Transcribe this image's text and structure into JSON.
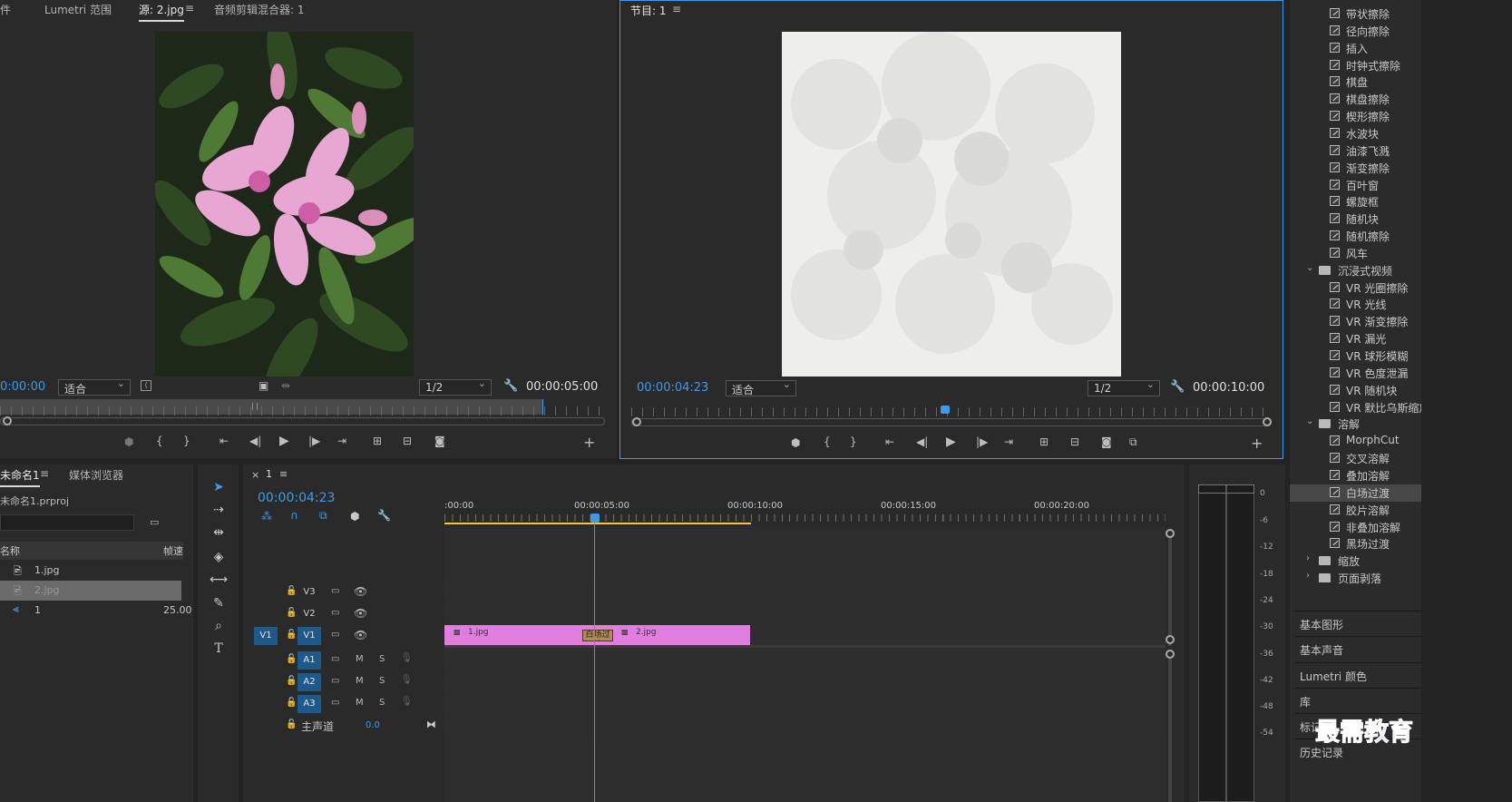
{
  "source_monitor": {
    "tabs": [
      "件",
      "Lumetri 范围",
      "源: 2.jpg",
      "音频剪辑混合器: 1"
    ],
    "menu_icon": "≡",
    "timecode_in": "0:00:00",
    "fit": "适合",
    "resolution": "1/2",
    "timecode_out": "00:00:05:00",
    "image_alt": "pink-azalea-flower-photo"
  },
  "program_monitor": {
    "tab": "节目: 1",
    "menu_icon": "≡",
    "timecode_in": "00:00:04:23",
    "fit": "适合",
    "resolution": "1/2",
    "timecode_out": "00:00:10:00",
    "playhead_fraction": 0.49
  },
  "project_panel": {
    "tabs": [
      "未命名1",
      "媒体浏览器"
    ],
    "menu_icon": "≡",
    "project_file": "未命名1.prproj",
    "columns": [
      "名称",
      "帧速"
    ],
    "items": [
      {
        "name": "1.jpg",
        "rate": "",
        "type": "image"
      },
      {
        "name": "2.jpg",
        "rate": "",
        "type": "image",
        "selected": true
      },
      {
        "name": "1",
        "rate": "25.00",
        "type": "sequence"
      }
    ]
  },
  "timeline": {
    "close": "×",
    "name": "1",
    "menu_icon": "≡",
    "timecode": "00:00:04:23",
    "ruler_labels": [
      ":00:00",
      "00:00:05:00",
      "00:00:10:00",
      "00:00:15:00",
      "00:00:20:00"
    ],
    "video_tracks": [
      {
        "label": "V3",
        "target": ""
      },
      {
        "label": "V2",
        "target": ""
      },
      {
        "label": "V1",
        "target": "V1"
      }
    ],
    "audio_tracks": [
      {
        "label": "A1",
        "m": "M",
        "s": "S"
      },
      {
        "label": "A2",
        "m": "M",
        "s": "S"
      },
      {
        "label": "A3",
        "m": "M",
        "s": "S"
      }
    ],
    "master": {
      "label": "主声道",
      "value": "0.0"
    },
    "clips": [
      {
        "name": "1.jpg"
      },
      {
        "name": "2.jpg"
      }
    ],
    "transition": "白场过渡"
  },
  "audio_meter": {
    "labels": [
      "0",
      "-6",
      "-12",
      "-18",
      "-24",
      "-30",
      "-36",
      "-42",
      "-48",
      "-54"
    ]
  },
  "effects_panel": {
    "items": [
      {
        "type": "item",
        "label": "带状擦除"
      },
      {
        "type": "item",
        "label": "径向擦除"
      },
      {
        "type": "item",
        "label": "插入"
      },
      {
        "type": "item",
        "label": "时钟式擦除"
      },
      {
        "type": "item",
        "label": "棋盘"
      },
      {
        "type": "item",
        "label": "棋盘擦除"
      },
      {
        "type": "item",
        "label": "楔形擦除"
      },
      {
        "type": "item",
        "label": "水波块"
      },
      {
        "type": "item",
        "label": "油漆飞溅"
      },
      {
        "type": "item",
        "label": "渐变擦除"
      },
      {
        "type": "item",
        "label": "百叶窗"
      },
      {
        "type": "item",
        "label": "螺旋框"
      },
      {
        "type": "item",
        "label": "随机块"
      },
      {
        "type": "item",
        "label": "随机擦除"
      },
      {
        "type": "item",
        "label": "风车"
      },
      {
        "type": "folder",
        "label": "沉浸式视频",
        "open": true
      },
      {
        "type": "item",
        "label": "VR 光圈擦除"
      },
      {
        "type": "item",
        "label": "VR 光线"
      },
      {
        "type": "item",
        "label": "VR 渐变擦除"
      },
      {
        "type": "item",
        "label": "VR 漏光"
      },
      {
        "type": "item",
        "label": "VR 球形模糊"
      },
      {
        "type": "item",
        "label": "VR 色度泄漏"
      },
      {
        "type": "item",
        "label": "VR 随机块"
      },
      {
        "type": "item",
        "label": "VR 默比乌斯缩放"
      },
      {
        "type": "folder",
        "label": "溶解",
        "open": true
      },
      {
        "type": "item",
        "label": "MorphCut"
      },
      {
        "type": "item",
        "label": "交叉溶解"
      },
      {
        "type": "item",
        "label": "叠加溶解"
      },
      {
        "type": "item",
        "label": "白场过渡",
        "selected": true
      },
      {
        "type": "item",
        "label": "胶片溶解"
      },
      {
        "type": "item",
        "label": "非叠加溶解"
      },
      {
        "type": "item",
        "label": "黑场过渡"
      },
      {
        "type": "folder",
        "label": "缩放",
        "open": false
      },
      {
        "type": "folder",
        "label": "页面剥落",
        "open": false
      }
    ],
    "sections": [
      "基本图形",
      "基本声音",
      "Lumetri 颜色",
      "库",
      "标记",
      "历史记录"
    ]
  },
  "watermark": "最需教育",
  "colors": {
    "accent": "#3a9bf0",
    "clip": "#e07ee0",
    "work_area": "#e8d22a",
    "track_target": "#1d5a8c"
  }
}
